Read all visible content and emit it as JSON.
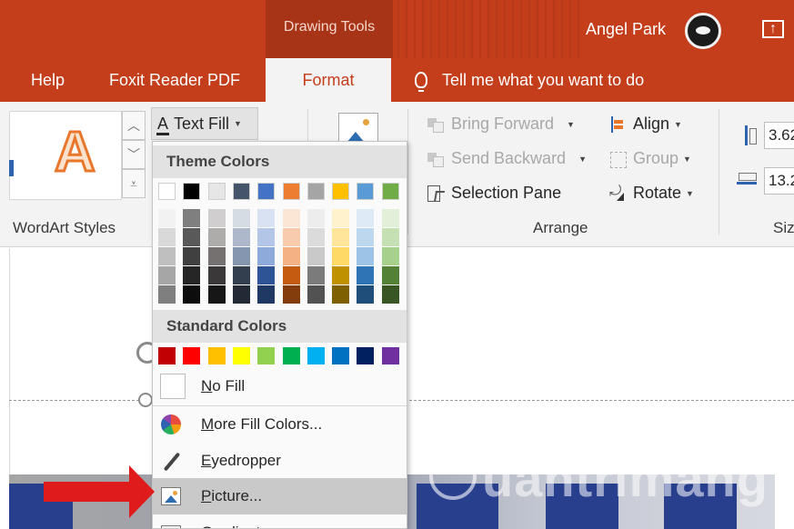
{
  "titlebar": {
    "contextual_tab": "Drawing Tools",
    "user_name": "Angel Park",
    "accent_color": "#c43e1c"
  },
  "tabs": {
    "help": "Help",
    "foxit": "Foxit Reader PDF",
    "format": "Format",
    "tell_me": "Tell me what you want to do"
  },
  "ribbon": {
    "wordart_styles_label": "WordArt Styles",
    "wordart_sample": "A",
    "text_fill_label": "Text Fill",
    "text_fill_icon": "A",
    "arrange_label": "Arrange",
    "bring_forward": "Bring Forward",
    "send_backward": "Send Backward",
    "selection_pane": "Selection Pane",
    "align": "Align",
    "group": "Group",
    "rotate": "Rotate",
    "size_label": "Siz",
    "height_value": "3.62",
    "width_value": "13.2"
  },
  "dropdown": {
    "theme_colors_header": "Theme Colors",
    "theme_top_row": [
      "#ffffff",
      "#000000",
      "#e7e6e6",
      "#44546a",
      "#4472c4",
      "#ed7d31",
      "#a5a5a5",
      "#ffc000",
      "#5b9bd5",
      "#70ad47"
    ],
    "theme_shades": [
      [
        "#f2f2f2",
        "#d9d9d9",
        "#bfbfbf",
        "#a6a6a6",
        "#7f7f7f"
      ],
      [
        "#7f7f7f",
        "#595959",
        "#404040",
        "#262626",
        "#0d0d0d"
      ],
      [
        "#d0cece",
        "#aeabab",
        "#757171",
        "#3a3838",
        "#171616"
      ],
      [
        "#d6dce4",
        "#adb9ca",
        "#8496b0",
        "#333f4f",
        "#222a35"
      ],
      [
        "#d9e2f3",
        "#b4c6e7",
        "#8eaadb",
        "#2f5496",
        "#1f3864"
      ],
      [
        "#fbe5d5",
        "#f7cbac",
        "#f4b183",
        "#c55a11",
        "#833c0b"
      ],
      [
        "#ededed",
        "#dbdbdb",
        "#c9c9c9",
        "#7b7b7b",
        "#525252"
      ],
      [
        "#fff2cc",
        "#fee599",
        "#ffd965",
        "#bf9000",
        "#7f6000"
      ],
      [
        "#deebf6",
        "#bdd7ee",
        "#9dc3e6",
        "#2e75b5",
        "#1e4e79"
      ],
      [
        "#e2efd9",
        "#c5e0b3",
        "#a8d08d",
        "#538135",
        "#375623"
      ]
    ],
    "standard_colors_header": "Standard Colors",
    "standard_colors": [
      "#c00000",
      "#ff0000",
      "#ffc000",
      "#ffff00",
      "#92d050",
      "#00b050",
      "#00b0f0",
      "#0070c0",
      "#002060",
      "#7030a0"
    ],
    "no_fill": {
      "pre": "",
      "key": "N",
      "post": "o Fill"
    },
    "more_fill_colors": {
      "pre": "",
      "key": "M",
      "post": "ore Fill Colors..."
    },
    "eyedropper": {
      "pre": "",
      "key": "E",
      "post": "yedropper"
    },
    "picture": {
      "pre": "",
      "key": "P",
      "post": "icture..."
    },
    "gradient": {
      "pre": "",
      "key": "G",
      "post": "radient"
    }
  },
  "watermark": "uantrimang"
}
